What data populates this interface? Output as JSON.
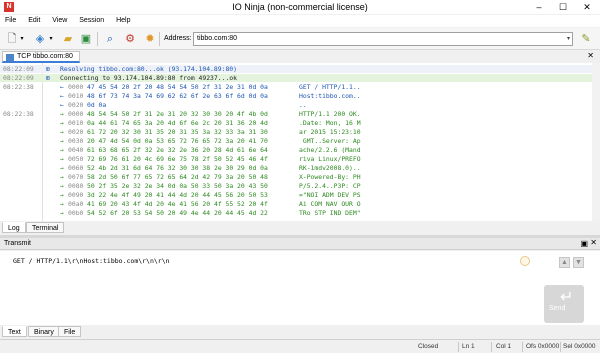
{
  "window": {
    "title": "IO Ninja (non-commercial license)",
    "app_icon": "io-ninja-logo-icon"
  },
  "menu": [
    "File",
    "Edit",
    "View",
    "Session",
    "Help"
  ],
  "toolbar": {
    "address_label": "Address:",
    "address_value": "tibbo.com:80",
    "icons": [
      "new-session-icon",
      "dropdown-icon",
      "open-icon",
      "dropdown-icon",
      "folder-icon",
      "save-icon",
      "find-icon",
      "settings-icon",
      "plugin-icon",
      "connect-icon"
    ]
  },
  "tabs": [
    {
      "label": "TCP tibbo.com:80"
    }
  ],
  "log": {
    "rows": [
      {
        "type": "info",
        "time": "08:22:09",
        "icon": "⊞",
        "text": "Resolving tibbo.com:80...ok (93.174.104.89:80)"
      },
      {
        "type": "green",
        "time": "08:22:09",
        "icon": "⊞",
        "text": "Connecting to 93.174.104.89:80 from 49237...ok"
      },
      {
        "type": "tx",
        "time": "08:22:38",
        "arrow": "←",
        "off": "0000",
        "hex": "47 45 54 20 2f 20 48 54 54 50 2f 31 2e 31 0d 0a",
        "ascii": "GET / HTTP/1.1.."
      },
      {
        "type": "tx",
        "time": "",
        "arrow": "←",
        "off": "0010",
        "hex": "48 6f 73 74 3a 74 69 62 62 6f 2e 63 6f 6d 0d 0a",
        "ascii": "Host:tibbo.com.."
      },
      {
        "type": "tx",
        "time": "",
        "arrow": "←",
        "off": "0020",
        "hex": "0d 0a",
        "ascii": ".."
      },
      {
        "type": "rx",
        "time": "08:22:38",
        "arrow": "→",
        "off": "0000",
        "hex": "48 54 54 50 2f 31 2e 31 20 32 30 30 20 4f 4b 0d",
        "ascii": "HTTP/1.1 200 OK."
      },
      {
        "type": "rx",
        "time": "",
        "arrow": "→",
        "off": "0010",
        "hex": "0a 44 61 74 65 3a 20 4d 6f 6e 2c 20 31 36 20 4d",
        "ascii": ".Date: Mon, 16 M"
      },
      {
        "type": "rx",
        "time": "",
        "arrow": "→",
        "off": "0020",
        "hex": "61 72 20 32 30 31 35 20 31 35 3a 32 33 3a 31 30",
        "ascii": "ar 2015 15:23:10"
      },
      {
        "type": "rx",
        "time": "",
        "arrow": "→",
        "off": "0030",
        "hex": "20 47 4d 54 0d 0a 53 65 72 76 65 72 3a 20 41 70",
        "ascii": " GMT..Server: Ap"
      },
      {
        "type": "rx",
        "time": "",
        "arrow": "→",
        "off": "0040",
        "hex": "61 63 68 65 2f 32 2e 32 2e 36 20 28 4d 61 6e 64",
        "ascii": "ache/2.2.6 (Mand"
      },
      {
        "type": "rx",
        "time": "",
        "arrow": "→",
        "off": "0050",
        "hex": "72 69 76 61 20 4c 69 6e 75 78 2f 50 52 45 46 4f",
        "ascii": "riva Linux/PREFO"
      },
      {
        "type": "rx",
        "time": "",
        "arrow": "→",
        "off": "0060",
        "hex": "52 4b 2d 31 6d 64 76 32 30 30 38 2e 30 29 0d 0a",
        "ascii": "RK-1mdv2008.0).."
      },
      {
        "type": "rx",
        "time": "",
        "arrow": "→",
        "off": "0070",
        "hex": "58 2d 50 6f 77 65 72 65 64 2d 42 79 3a 20 50 48",
        "ascii": "X-Powered-By: PH"
      },
      {
        "type": "rx",
        "time": "",
        "arrow": "→",
        "off": "0080",
        "hex": "50 2f 35 2e 32 2e 34 0d 0a 50 33 50 3a 20 43 50",
        "ascii": "P/5.2.4..P3P: CP"
      },
      {
        "type": "rx",
        "time": "",
        "arrow": "→",
        "off": "0090",
        "hex": "3d 22 4e 4f 49 20 41 44 4d 20 44 45 56 20 50 53",
        "ascii": "=\"NOI ADM DEV PS"
      },
      {
        "type": "rx",
        "time": "",
        "arrow": "→",
        "off": "00a0",
        "hex": "41 69 20 43 4f 4d 20 4e 41 56 20 4f 55 52 20 4f",
        "ascii": "Ai COM NAV OUR O"
      },
      {
        "type": "rx",
        "time": "",
        "arrow": "→",
        "off": "00b0",
        "hex": "54 52 6f 20 53 54 50 20 49 4e 44 20 44 45 4d 22",
        "ascii": "TRo STP IND DEM\""
      }
    ]
  },
  "bottom_tabs": [
    "Log",
    "Terminal"
  ],
  "transmit": {
    "header": "Transmit",
    "text": "GET / HTTP/1.1\\r\\nHost:tibbo.com\\r\\n\\r\\n",
    "send_label": "Send",
    "tabs": [
      "Text",
      "Binary",
      "File"
    ]
  },
  "status": {
    "state": "Closed",
    "ln": "Ln 1",
    "col": "Col 1",
    "ofs": "Ofs 0x0000",
    "sel": "Sel 0x0000"
  },
  "colors": {
    "accent": "#3c7dd6",
    "tx": "#1d55b3",
    "rx": "#2c8a1f",
    "info_row": "#eef1f8",
    "ok_row": "#e4f3dc"
  }
}
